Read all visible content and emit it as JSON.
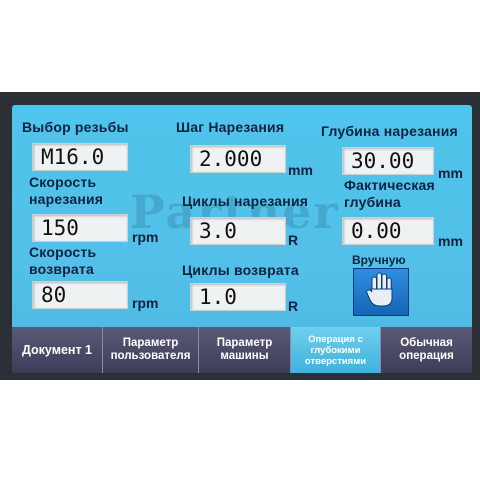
{
  "fields": {
    "thread_select": {
      "label": "Выбор резьбы",
      "value": "M16.0"
    },
    "cut_pitch": {
      "label": "Шаг Нарезания",
      "value": "2.000",
      "unit": "mm"
    },
    "cut_depth": {
      "label": "Глубина нарезания",
      "value": "30.00",
      "unit": "mm"
    },
    "cut_speed": {
      "label_line1": "Скорость",
      "label_line2": "нарезания",
      "value": "150",
      "unit": "rpm"
    },
    "cut_cycles": {
      "label": "Циклы нарезания",
      "value": "3.0",
      "unit": "R"
    },
    "actual_depth": {
      "label_line1": "Фактическая",
      "label_line2": "глубина",
      "value": "0.00",
      "unit": "mm"
    },
    "return_speed": {
      "label_line1": "Скорость",
      "label_line2": "возврата",
      "value": "80",
      "unit": "rpm"
    },
    "return_cycles": {
      "label": "Циклы возврата",
      "value": "1.0",
      "unit": "R"
    }
  },
  "manual": {
    "label": "Вручную",
    "icon": "hand-stop-icon"
  },
  "watermark": "Partner",
  "tabs": [
    {
      "line1": "Документ 1",
      "line2": "",
      "active": false
    },
    {
      "line1": "Параметр",
      "line2": "пользователя",
      "active": false
    },
    {
      "line1": "Параметр",
      "line2": "машины",
      "active": false
    },
    {
      "line1": "Операция с",
      "line2": "глубокими отверстиями",
      "active": true
    },
    {
      "line1": "Обычная",
      "line2": "операция",
      "active": false
    }
  ],
  "colors": {
    "screen": "#52c0e8",
    "tabbar": "#3d3d58",
    "active_tab": "#3fb2dc",
    "manual_button": "#1565b8"
  }
}
